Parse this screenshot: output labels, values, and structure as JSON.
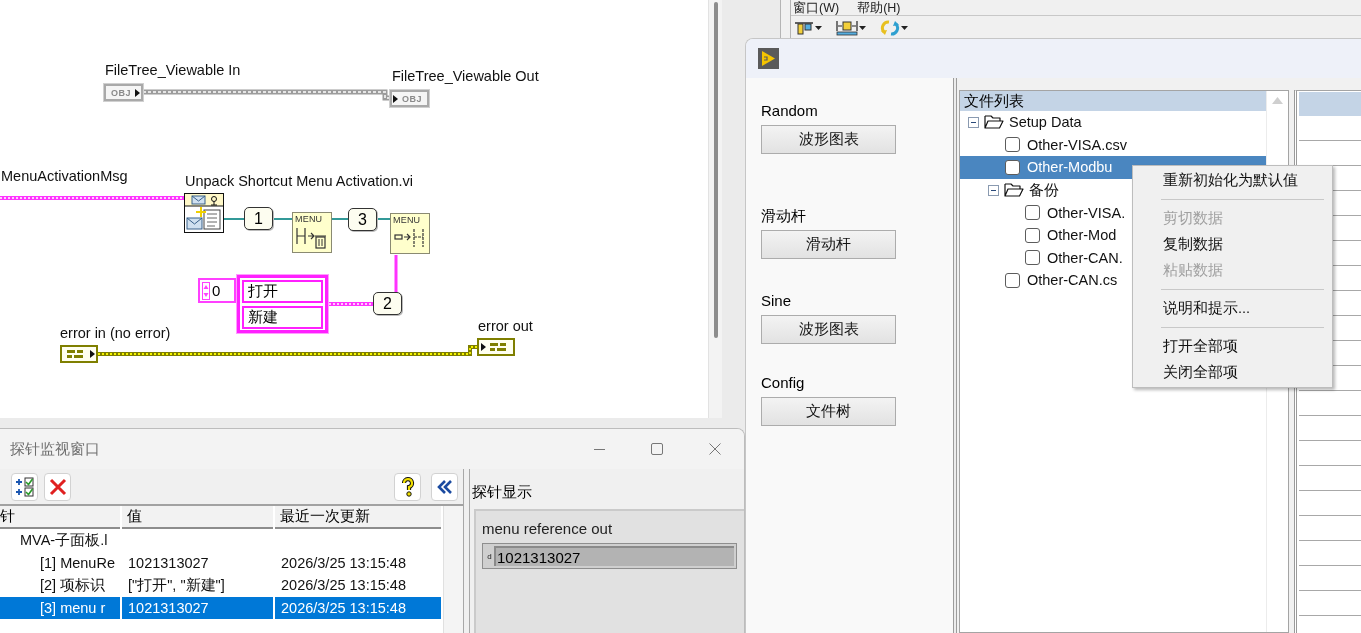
{
  "block_diagram": {
    "object_terminals": [
      {
        "kind": "control",
        "label": "FileTree_Viewable In",
        "type": "OBJ"
      },
      {
        "kind": "indicator",
        "label": "FileTree_Viewable Out",
        "type": "OBJ"
      }
    ],
    "message_input": {
      "label": "MenuActivationMsg"
    },
    "unpack_node": {
      "label": "Unpack Shortcut Menu Activation.vi"
    },
    "constants": [
      {
        "kind": "numeric",
        "text": "1"
      },
      {
        "kind": "numeric",
        "text": "3"
      },
      {
        "kind": "numeric",
        "text": "2"
      }
    ],
    "menu_nodes": [
      {
        "kind": "delete",
        "text": "MENU"
      },
      {
        "kind": "insert",
        "text": "MENU"
      }
    ],
    "array_constant": {
      "index": "0",
      "items": [
        "打开",
        "新建"
      ]
    },
    "error_terminals": [
      {
        "kind": "control",
        "label": "error in (no error)"
      },
      {
        "kind": "indicator",
        "label": "error out"
      }
    ]
  },
  "editor_window": {
    "menu": [
      "窗口(W)",
      "帮助(H)"
    ]
  },
  "run_window": {
    "panel_controls": [
      {
        "label": "Random",
        "button": "波形图表"
      },
      {
        "label": "滑动杆",
        "button": "滑动杆"
      },
      {
        "label": "Sine",
        "button": "波形图表"
      },
      {
        "label": "Config",
        "button": "文件树"
      }
    ],
    "file_tree": {
      "header": "文件列表",
      "items": [
        {
          "kind": "folder",
          "label": "Setup Data",
          "expanded": true,
          "selected": false,
          "children": [
            {
              "kind": "file",
              "label": "Other-VISA.csv",
              "checked": false,
              "selected": false
            },
            {
              "kind": "file",
              "label": "Other-Modbu",
              "checked": false,
              "selected": true
            },
            {
              "kind": "folder",
              "label": "备份",
              "expanded": true,
              "selected": false,
              "children": [
                {
                  "kind": "file",
                  "label": "Other-VISA.",
                  "checked": false,
                  "selected": false
                },
                {
                  "kind": "file",
                  "label": "Other-Mod",
                  "checked": false,
                  "selected": false
                },
                {
                  "kind": "file",
                  "label": "Other-CAN.",
                  "checked": false,
                  "selected": false
                }
              ]
            },
            {
              "kind": "file",
              "label": "Other-CAN.cs",
              "checked": false,
              "selected": false
            }
          ]
        }
      ]
    },
    "context_menu": [
      {
        "kind": "item",
        "label": "重新初始化为默认值",
        "disabled": false
      },
      {
        "kind": "separator"
      },
      {
        "kind": "item",
        "label": "剪切数据",
        "disabled": true
      },
      {
        "kind": "item",
        "label": "复制数据",
        "disabled": false
      },
      {
        "kind": "item",
        "label": "粘贴数据",
        "disabled": true
      },
      {
        "kind": "separator"
      },
      {
        "kind": "item",
        "label": "说明和提示...",
        "disabled": false
      },
      {
        "kind": "separator"
      },
      {
        "kind": "item",
        "label": "打开全部项",
        "disabled": false
      },
      {
        "kind": "item",
        "label": "关闭全部项",
        "disabled": false
      }
    ]
  },
  "probe_window": {
    "title": "探针监视窗口",
    "columns": [
      "针",
      "值",
      "最近一次更新"
    ],
    "rows": [
      {
        "cells": [
          "MVA-子面板.l"
        ],
        "selected": false,
        "children": [
          {
            "cells": [
              "[1] MenuRe",
              "1021313027",
              "2026/3/25 13:15:48"
            ],
            "selected": false
          },
          {
            "cells": [
              "[2] 项标识",
              "[\"打开\", \"新建\"]",
              "2026/3/25 13:15:48"
            ],
            "selected": false
          },
          {
            "cells": [
              "[3] menu r",
              "1021313027",
              "2026/3/25 13:15:48"
            ],
            "selected": true
          }
        ]
      }
    ],
    "display": {
      "title": "探针显示",
      "probe_label": "menu reference out",
      "radix": "d",
      "value": "1021313027"
    }
  }
}
